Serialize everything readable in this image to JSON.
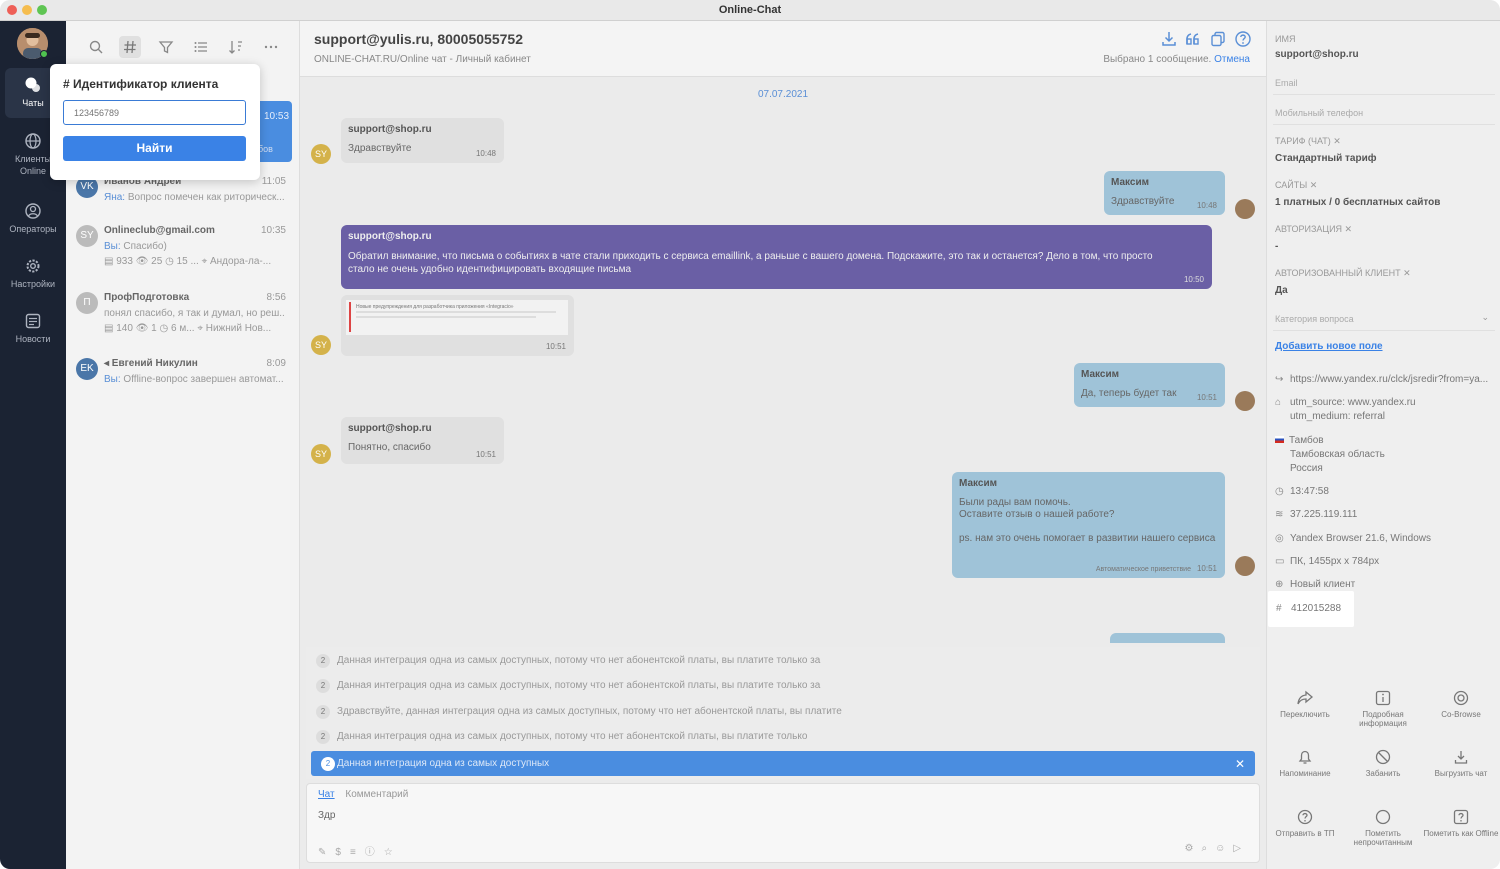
{
  "window": {
    "title": "Online-Chat"
  },
  "rail": {
    "items": [
      {
        "label": "Чаты"
      },
      {
        "label": "Клиенты Online"
      },
      {
        "label": "Операторы"
      },
      {
        "label": "Настройки"
      },
      {
        "label": "Новости"
      }
    ]
  },
  "popup": {
    "title": "# Идентификатор клиента",
    "placeholder": "123456789",
    "button": "Найти"
  },
  "selected_chat": {
    "time": "10:53",
    "snippet": "бов"
  },
  "chats": [
    {
      "initials": "VK",
      "name": "Иванов Андрей",
      "time": "11:05",
      "who": "Яна:",
      "text": "Вопрос помечен как риторическ...",
      "color": "#4a76a8"
    },
    {
      "initials": "SY",
      "name": "Onlineclub@gmail.com",
      "time": "10:35",
      "who": "Вы:",
      "text": "Спасибо)",
      "meta": "▤ 933   👁 25   ◷ 15 ...   ⌖ Андора-ла-...",
      "color": "#bbbbbb"
    },
    {
      "initials": "П",
      "name": "ПрофПодготовка",
      "time": "8:56",
      "who": "",
      "text": "понял спасибо, я так и думал, но реш...",
      "meta": "▤ 140   👁 1   ◷ 6 м...   ⌖ Нижний Нов...",
      "color": "#bbbbbb"
    },
    {
      "initials": "EK",
      "name": "◂ Евгений Никулин",
      "time": "8:09",
      "who": "Вы:",
      "text": "Offline-вопрос завершен автомат...",
      "color": "#4a76a8"
    }
  ],
  "header": {
    "title": "support@yulis.ru, 80005055752",
    "subtitle": "ONLINE-CHAT.RU/Online чат - Личный кабинет",
    "selected": "Выбрано 1 сообщение.",
    "cancel": "Отмена"
  },
  "date": "07.07.2021",
  "messages": {
    "m1": {
      "name": "support@shop.ru",
      "text": "Здравствуйте",
      "time": "10:48",
      "avatar": "SY"
    },
    "m2": {
      "name": "Максим",
      "text": "Здравствуйте",
      "time": "10:48"
    },
    "m3": {
      "name": "support@shop.ru",
      "text": "Обратил внимание, что письма о событиях в чате стали приходить с сервиса emaillink, а раньше с вашего домена. Подскажите, это так и останется? Дело в том, что просто стало не очень удобно идентифицировать входящие письма",
      "time": "10:50"
    },
    "m4": {
      "time": "10:51",
      "avatar": "SY",
      "preview": "Новые предупреждения для разработчика приложения «Integracio»"
    },
    "m5": {
      "name": "Максим",
      "text": "Да, теперь будет так",
      "time": "10:51"
    },
    "m6": {
      "name": "support@shop.ru",
      "text": "Понятно, спасибо",
      "time": "10:51",
      "avatar": "SY"
    },
    "m7": {
      "name": "Максим",
      "line1": "Были рады вам помочь.",
      "line2": "Оставите отзыв о нашей работе?",
      "line3": "ps. нам это очень помогает в развитии нашего сервиса",
      "tag": "Автоматическое приветствие",
      "time": "10:51"
    }
  },
  "quick_replies": [
    {
      "num": "2",
      "text": "Данная интеграция одна из самых доступных, потому что нет абонентской платы, вы платите только за"
    },
    {
      "num": "2",
      "text": "Данная интеграция одна из самых доступных, потому что нет абонентской платы, вы платите только за"
    },
    {
      "num": "2",
      "text": "Здравствуйте, данная интеграция одна из самых доступных, потому что нет абонентской платы, вы платите"
    },
    {
      "num": "2",
      "text": "Данная интеграция одна из самых доступных, потому что нет абонентской платы, вы платите только"
    },
    {
      "num": "2",
      "text": "Данная интеграция одна из самых доступных"
    }
  ],
  "composer": {
    "tab_chat": "Чат",
    "tab_comment": "Комментарий",
    "text": "Здр"
  },
  "client": {
    "name_label": "ИМЯ",
    "name": "support@shop.ru",
    "email_placeholder": "Email",
    "phone_placeholder": "Мобильный телефон",
    "tariff_label": "ТАРИФ (ЧАТ) ✕",
    "tariff": "Стандартный тариф",
    "sites_label": "САЙТЫ ✕",
    "sites": "1 платных / 0 бесплатных сайтов",
    "auth_label": "АВТОРИЗАЦИЯ ✕",
    "auth": "-",
    "authclient_label": "АВТОРИЗОВАННЫЙ КЛИЕНТ ✕",
    "authclient": "Да",
    "category_placeholder": "Категория вопроса",
    "add_field": "Добавить новое поле",
    "referrer": "https://www.yandex.ru/clck/jsredir?from=ya...",
    "utm1": "utm_source: www.yandex.ru",
    "utm2": "utm_medium: referral",
    "city": "Тамбов",
    "region": "Тамбовская область",
    "country": "Россия",
    "time": "13:47:58",
    "ip": "37.225.119.111",
    "browser": "Yandex Browser 21.6, Windows",
    "device": "ПК, 1455px x 784px",
    "status": "Новый клиент",
    "id": "412015288"
  },
  "actions": [
    {
      "label": "Переключить"
    },
    {
      "label": "Подробная информация"
    },
    {
      "label": "Co-Browse"
    },
    {
      "label": "Напоминание"
    },
    {
      "label": "Забанить"
    },
    {
      "label": "Выгрузить чат"
    },
    {
      "label": "Отправить в ТП"
    },
    {
      "label": "Пометить непрочитанным"
    },
    {
      "label": "Пометить как Offline"
    }
  ]
}
